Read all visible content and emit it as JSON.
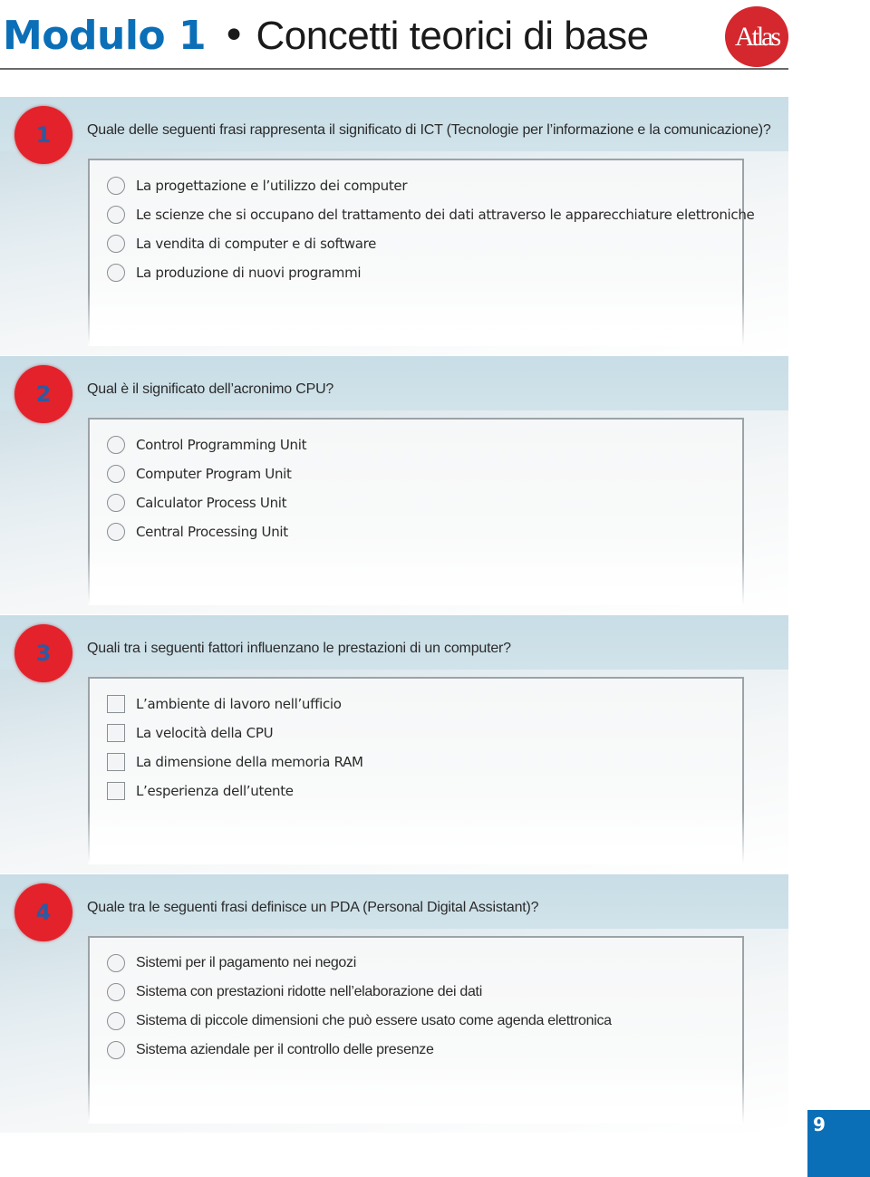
{
  "header": {
    "module": "Modulo 1",
    "separator": "•",
    "subtitle": "Concetti teorici di base",
    "logo_text": "Atlas"
  },
  "colors": {
    "brand_blue": "#0b6fb8",
    "badge_red": "#e3222b",
    "band": "#cfe0e7"
  },
  "questions": [
    {
      "number": "1",
      "text": "Quale delle seguenti frasi rappresenta il significato di ICT (Tecnologie per l’informazione e la comunicazione)?",
      "input_type": "radio",
      "options": [
        "La progettazione e l’utilizzo dei computer",
        "Le scienze che si occupano del trattamento dei dati attraverso le apparecchiature elettroniche",
        "La vendita di computer e di software",
        "La produzione di nuovi programmi"
      ]
    },
    {
      "number": "2",
      "text": "Qual è il significato dell’acronimo CPU?",
      "input_type": "radio",
      "options": [
        "Control Programming Unit",
        "Computer Program Unit",
        "Calculator Process Unit",
        "Central Processing Unit"
      ]
    },
    {
      "number": "3",
      "text": "Quali tra i seguenti fattori influenzano le prestazioni di un computer?",
      "input_type": "checkbox",
      "options": [
        "L’ambiente di lavoro nell’ufficio",
        "La velocità della CPU",
        "La dimensione della memoria RAM",
        "L’esperienza dell’utente"
      ]
    },
    {
      "number": "4",
      "text": "Quale tra le seguenti frasi definisce un PDA (Personal Digital Assistant)?",
      "input_type": "radio",
      "options": [
        "Sistemi per il pagamento nei negozi",
        "Sistema con prestazioni ridotte nell’elaborazione dei dati",
        "Sistema di piccole dimensioni che può essere usato come agenda elettronica",
        "Sistema aziendale per il controllo delle presenze"
      ]
    }
  ],
  "footer": {
    "page_number": "9"
  }
}
